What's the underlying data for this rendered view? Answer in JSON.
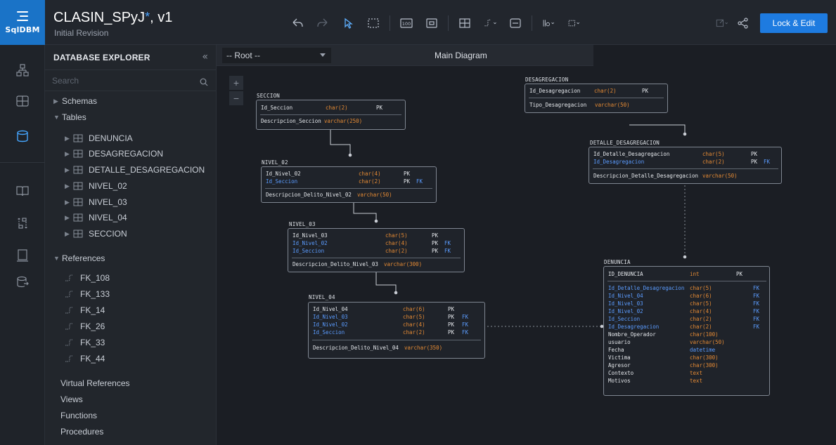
{
  "app": {
    "logo_text": "SqlDBM"
  },
  "project": {
    "title": "CLASIN_SPyJ",
    "dirty_marker": "*",
    "version": ", v1",
    "subtitle": "Initial Revision"
  },
  "toolbar": {
    "lock_edit_label": "Lock & Edit",
    "zoom_label": "100"
  },
  "explorer": {
    "title": "DATABASE EXPLORER",
    "collapse": "«",
    "search_placeholder": "Search",
    "schemas_label": "Schemas",
    "tables_label": "Tables",
    "tables": [
      "DENUNCIA",
      "DESAGREGACION",
      "DETALLE_DESAGREGACION",
      "NIVEL_02",
      "NIVEL_03",
      "NIVEL_04",
      "SECCION"
    ],
    "references_label": "References",
    "references": [
      "FK_108",
      "FK_133",
      "FK_14",
      "FK_26",
      "FK_33",
      "FK_44"
    ],
    "virtual_references_label": "Virtual References",
    "views_label": "Views",
    "functions_label": "Functions",
    "procedures_label": "Procedures"
  },
  "canvas": {
    "root_label": "-- Root --",
    "diagram_tab": "Main Diagram",
    "zoom_in": "+",
    "zoom_out": "−"
  },
  "entities": {
    "seccion": {
      "name": "SECCION",
      "columns": [
        {
          "name": "Id_Seccion",
          "type": "char(2)",
          "pk": "PK",
          "fk": ""
        }
      ],
      "attributes": [
        {
          "name": "Descripcion_Seccion",
          "type": "varchar(250)"
        }
      ]
    },
    "nivel02": {
      "name": "NIVEL_02",
      "columns": [
        {
          "name": "Id_Nivel_02",
          "type": "char(4)",
          "pk": "PK",
          "fk": ""
        },
        {
          "name": "Id_Seccion",
          "type": "char(2)",
          "pk": "PK",
          "fk": "FK"
        }
      ],
      "attributes": [
        {
          "name": "Descripcion_Delito_Nivel_02",
          "type": "varchar(50)"
        }
      ]
    },
    "nivel03": {
      "name": "NIVEL_03",
      "columns": [
        {
          "name": "Id_Nivel_03",
          "type": "char(5)",
          "pk": "PK",
          "fk": ""
        },
        {
          "name": "Id_Nivel_02",
          "type": "char(4)",
          "pk": "PK",
          "fk": "FK"
        },
        {
          "name": "Id_Seccion",
          "type": "char(2)",
          "pk": "PK",
          "fk": "FK"
        }
      ],
      "attributes": [
        {
          "name": "Descripcion_Delito_Nivel_03",
          "type": "varchar(300)"
        }
      ]
    },
    "nivel04": {
      "name": "NIVEL_04",
      "columns": [
        {
          "name": "Id_Nivel_04",
          "type": "char(6)",
          "pk": "PK",
          "fk": ""
        },
        {
          "name": "Id_Nivel_03",
          "type": "char(5)",
          "pk": "PK",
          "fk": "FK"
        },
        {
          "name": "Id_Nivel_02",
          "type": "char(4)",
          "pk": "PK",
          "fk": "FK"
        },
        {
          "name": "Id_Seccion",
          "type": "char(2)",
          "pk": "PK",
          "fk": "FK"
        }
      ],
      "attributes": [
        {
          "name": "Descripcion_Delito_Nivel_04",
          "type": "varchar(350)"
        }
      ]
    },
    "desagregacion": {
      "name": "DESAGREGACION",
      "columns": [
        {
          "name": "Id_Desagregacion",
          "type": "char(2)",
          "pk": "PK",
          "fk": ""
        }
      ],
      "attributes": [
        {
          "name": "Tipo_Desagregacion",
          "type": "varchar(50)"
        }
      ]
    },
    "detalle": {
      "name": "DETALLE_DESAGREGACION",
      "columns": [
        {
          "name": "Id_Detalle_Desagregacion",
          "type": "char(5)",
          "pk": "PK",
          "fk": ""
        },
        {
          "name": "Id_Desagregacion",
          "type": "char(2)",
          "pk": "PK",
          "fk": "FK"
        }
      ],
      "attributes": [
        {
          "name": "Descripcion_Detalle_Desagregacion",
          "type": "varchar(50)"
        }
      ]
    },
    "denuncia": {
      "name": "DENUNCIA",
      "columns": [
        {
          "name": "ID_DENUNCIA",
          "type": "int",
          "pk": "PK",
          "fk": ""
        }
      ],
      "fk_columns": [
        {
          "name": "Id_Detalle_Desagregacion",
          "type": "char(5)",
          "fk": "FK"
        },
        {
          "name": "Id_Nivel_04",
          "type": "char(6)",
          "fk": "FK"
        },
        {
          "name": "Id_Nivel_03",
          "type": "char(5)",
          "fk": "FK"
        },
        {
          "name": "Id_Nivel_02",
          "type": "char(4)",
          "fk": "FK"
        },
        {
          "name": "Id_Seccion",
          "type": "char(2)",
          "fk": "FK"
        },
        {
          "name": "Id_Desagregacion",
          "type": "char(2)",
          "fk": "FK"
        }
      ],
      "attributes": [
        {
          "name": "Nombre_Operador",
          "type": "char(100)"
        },
        {
          "name": "usuario",
          "type": "varchar(50)"
        },
        {
          "name": "Fecha",
          "type": "datetime"
        },
        {
          "name": "Victima",
          "type": "char(300)"
        },
        {
          "name": "Agresor",
          "type": "char(300)"
        },
        {
          "name": "Contexto",
          "type": "text"
        },
        {
          "name": "Motivos",
          "type": "text"
        }
      ]
    }
  }
}
